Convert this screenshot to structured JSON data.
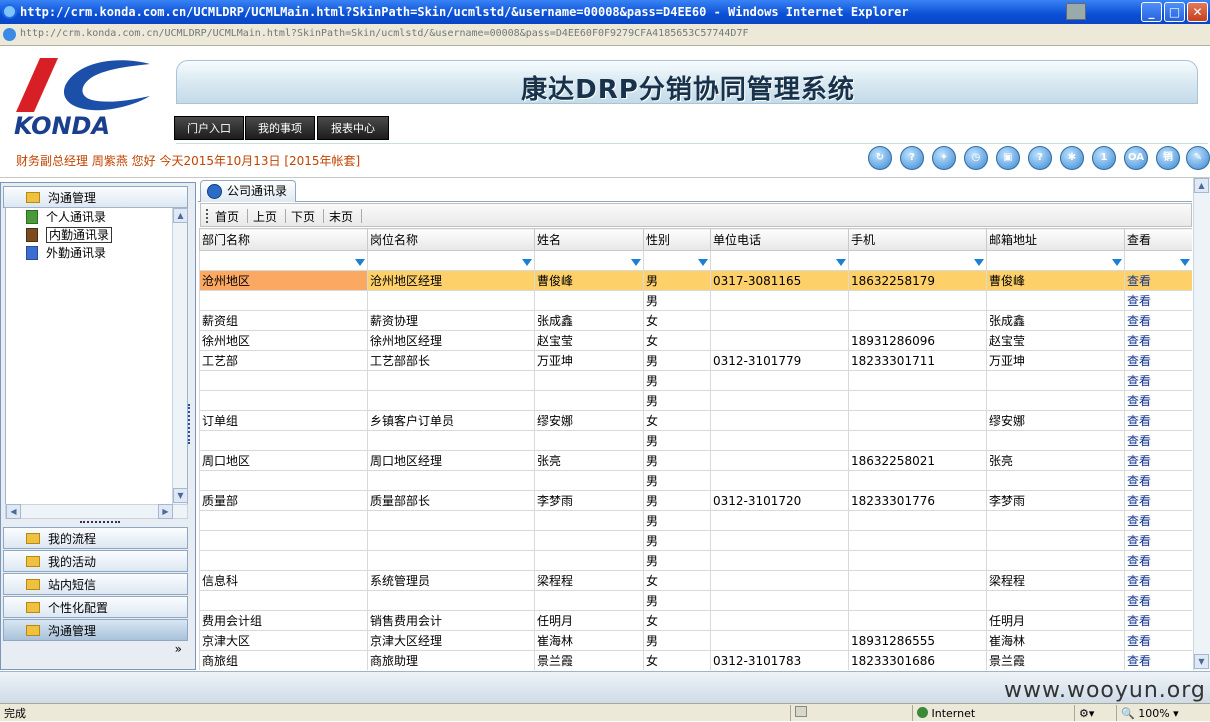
{
  "window": {
    "title": "http://crm.konda.com.cn/UCMLDRP/UCMLMain.html?SkinPath=Skin/ucmlstd/&username=00008&pass=D4EE60 - Windows Internet Explorer",
    "minimize": "_",
    "maximize": "□",
    "close": "✕"
  },
  "address": "http://crm.konda.com.cn/UCMLDRP/UCMLMain.html?SkinPath=Skin/ucmlstd/&username=00008&pass=D4EE60F0F9279CFA4185653C57744D7F",
  "logo_text": "KONDA",
  "system_title": "康达DRP分销协同管理系统",
  "top_nav": [
    "门户入口",
    "我的事项",
    "报表中心"
  ],
  "welcome": "财务副总经理 周紫燕 您好 今天2015年10月13日 [2015年帐套]",
  "toolbar_icons": [
    {
      "name": "refresh-icon",
      "glyph": "↻"
    },
    {
      "name": "help-circle-icon",
      "glyph": "?"
    },
    {
      "name": "lightbulb-icon",
      "glyph": "✦"
    },
    {
      "name": "clock-icon",
      "glyph": "◷"
    },
    {
      "name": "lock-icon",
      "glyph": "▣"
    },
    {
      "name": "question-icon",
      "glyph": "?"
    },
    {
      "name": "running-man-icon",
      "glyph": "✱"
    },
    {
      "name": "info-icon",
      "glyph": "1"
    },
    {
      "name": "oa-icon",
      "glyph": "OA"
    },
    {
      "name": "sales-icon",
      "glyph": "销"
    },
    {
      "name": "brush-icon",
      "glyph": "✎"
    }
  ],
  "left_panel": {
    "top_group": "沟通管理",
    "tree": [
      {
        "label": "个人通讯录",
        "selected": false
      },
      {
        "label": "内勤通讯录",
        "selected": true
      },
      {
        "label": "外勤通讯录",
        "selected": false
      }
    ],
    "groups": [
      "我的流程",
      "我的活动",
      "站内短信",
      "个性化配置",
      "沟通管理"
    ],
    "more": "»"
  },
  "content": {
    "tab_label": "公司通讯录",
    "pager": [
      "首页",
      "上页",
      "下页",
      "末页"
    ],
    "columns": [
      "部门名称",
      "岗位名称",
      "姓名",
      "性别",
      "单位电话",
      "手机",
      "邮箱地址",
      "查看"
    ],
    "rows": [
      [
        "沧州地区",
        "沧州地区经理",
        "曹俊峰",
        "男",
        "0317-3081165",
        "18632258179",
        "曹俊峰",
        "查看"
      ],
      [
        "",
        "",
        "",
        "男",
        "",
        "",
        "",
        "查看"
      ],
      [
        "薪资组",
        "薪资协理",
        "张成鑫",
        "女",
        "",
        "",
        "张成鑫",
        "查看"
      ],
      [
        "徐州地区",
        "徐州地区经理",
        "赵宝莹",
        "女",
        "",
        "18931286096",
        "赵宝莹",
        "查看"
      ],
      [
        "工艺部",
        "工艺部部长",
        "万亚坤",
        "男",
        "0312-3101779",
        "18233301711",
        "万亚坤",
        "查看"
      ],
      [
        "",
        "",
        "",
        "男",
        "",
        "",
        "",
        "查看"
      ],
      [
        "",
        "",
        "",
        "男",
        "",
        "",
        "",
        "查看"
      ],
      [
        "订单组",
        "乡镇客户订单员",
        "缪安娜",
        "女",
        "",
        "",
        "缪安娜",
        "查看"
      ],
      [
        "",
        "",
        "",
        "男",
        "",
        "",
        "",
        "查看"
      ],
      [
        "周口地区",
        "周口地区经理",
        "张亮",
        "男",
        "",
        "18632258021",
        "张亮",
        "查看"
      ],
      [
        "",
        "",
        "",
        "男",
        "",
        "",
        "",
        "查看"
      ],
      [
        "质量部",
        "质量部部长",
        "李梦雨",
        "男",
        "0312-3101720",
        "18233301776",
        "李梦雨",
        "查看"
      ],
      [
        "",
        "",
        "",
        "男",
        "",
        "",
        "",
        "查看"
      ],
      [
        "",
        "",
        "",
        "男",
        "",
        "",
        "",
        "查看"
      ],
      [
        "",
        "",
        "",
        "男",
        "",
        "",
        "",
        "查看"
      ],
      [
        "信息科",
        "系统管理员",
        "梁程程",
        "女",
        "",
        "",
        "梁程程",
        "查看"
      ],
      [
        "",
        "",
        "",
        "男",
        "",
        "",
        "",
        "查看"
      ],
      [
        "费用会计组",
        "销售费用会计",
        "任明月",
        "女",
        "",
        "",
        "任明月",
        "查看"
      ],
      [
        "京津大区",
        "京津大区经理",
        "崔海林",
        "男",
        "",
        "18931286555",
        "崔海林",
        "查看"
      ],
      [
        "商旅组",
        "商旅助理",
        "景兰霞",
        "女",
        "0312-3101783",
        "18233301686",
        "景兰霞",
        "查看"
      ]
    ],
    "highlight_row": 0
  },
  "watermark": "www.wooyun.org",
  "status": {
    "left": "完成",
    "zone": "Internet",
    "zoom": "100%"
  }
}
